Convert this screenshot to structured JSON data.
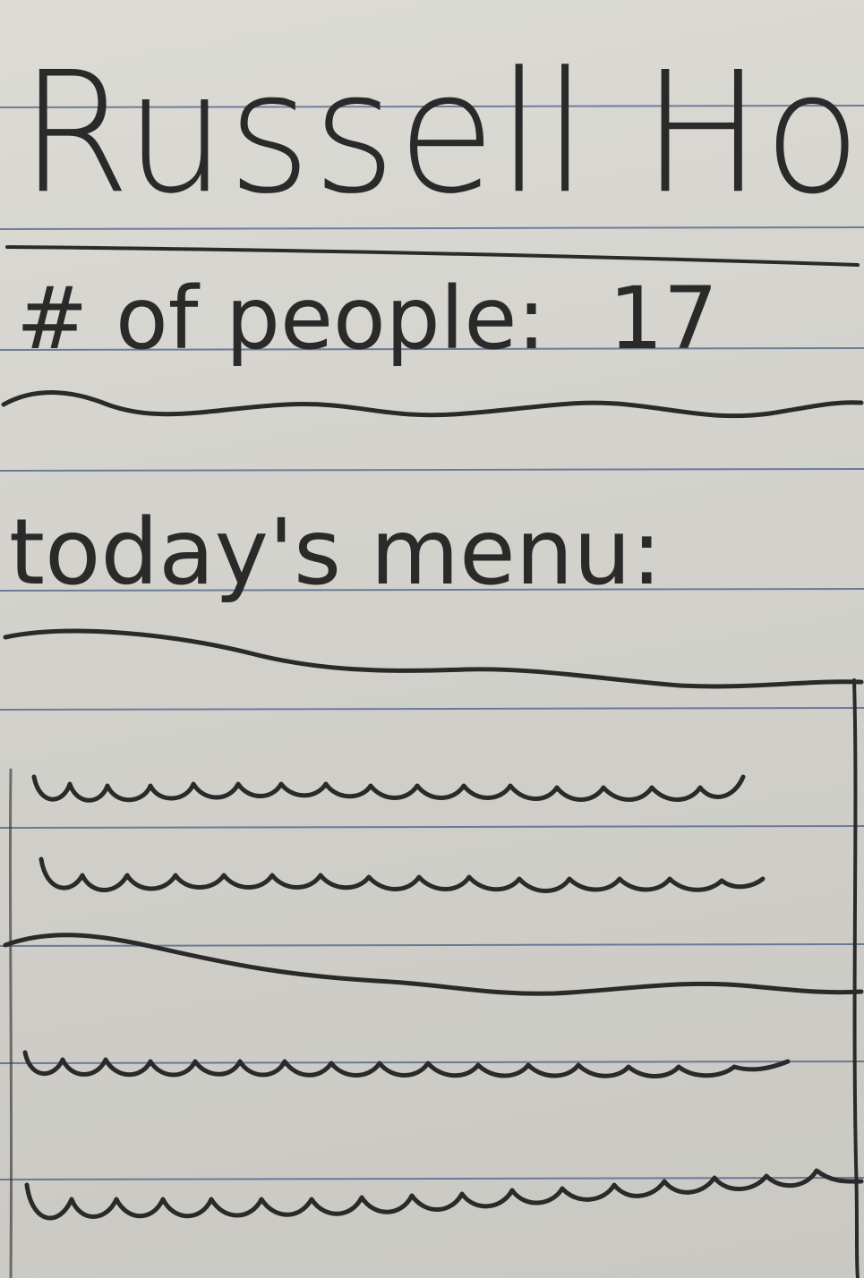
{
  "card": {
    "title": "Russell House",
    "people_label": "# of people:",
    "people_count": "17",
    "menu_heading": "today's menu:"
  },
  "colors": {
    "paper": "#d6d5cf",
    "rule_line": "#4a5f86",
    "ink": "#2b2a2a"
  }
}
